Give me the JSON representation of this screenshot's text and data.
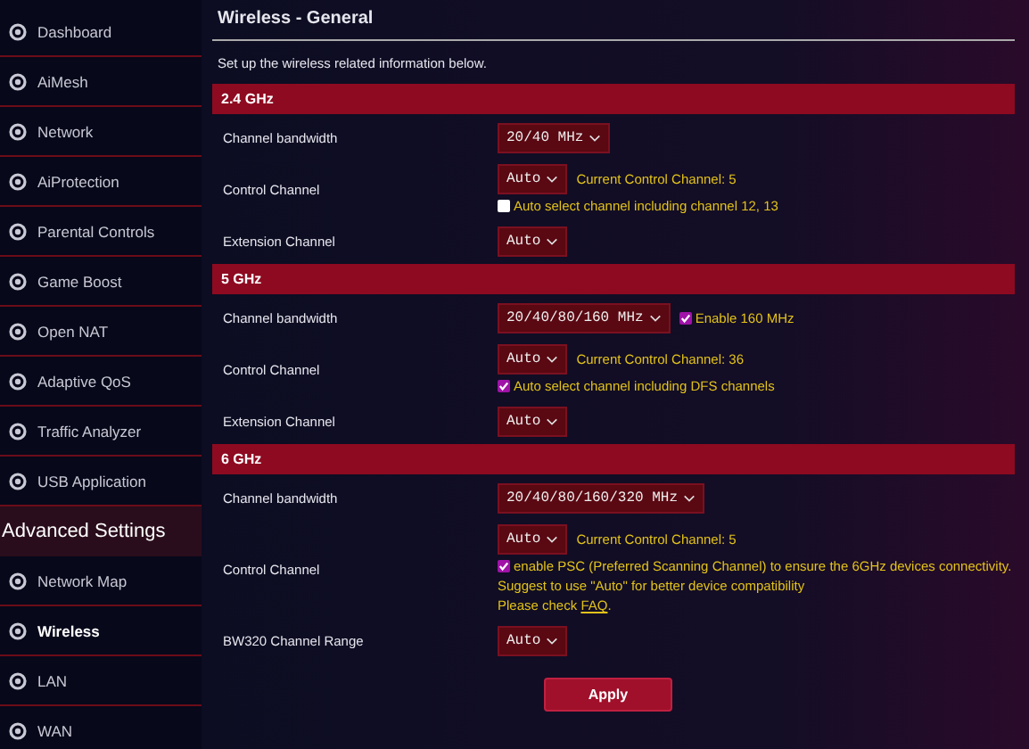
{
  "sidebar": {
    "items": [
      {
        "kind": "item",
        "label": "Dashboard",
        "selected": false
      },
      {
        "kind": "item",
        "label": "AiMesh",
        "selected": false
      },
      {
        "kind": "item",
        "label": "Network",
        "selected": false
      },
      {
        "kind": "item",
        "label": "AiProtection",
        "selected": false
      },
      {
        "kind": "item",
        "label": "Parental Controls",
        "selected": false
      },
      {
        "kind": "item",
        "label": "Game Boost",
        "selected": false
      },
      {
        "kind": "item",
        "label": "Open NAT",
        "selected": false
      },
      {
        "kind": "item",
        "label": "Adaptive QoS",
        "selected": false
      },
      {
        "kind": "item",
        "label": "Traffic Analyzer",
        "selected": false
      },
      {
        "kind": "item",
        "label": "USB Application",
        "selected": false
      },
      {
        "kind": "heading",
        "label": "Advanced Settings"
      },
      {
        "kind": "item",
        "label": "Network Map",
        "selected": false
      },
      {
        "kind": "item",
        "label": "Wireless",
        "selected": true
      },
      {
        "kind": "item",
        "label": "LAN",
        "selected": false
      },
      {
        "kind": "item",
        "label": "WAN",
        "selected": false
      }
    ]
  },
  "page": {
    "title": "Wireless - General",
    "intro": "Set up the wireless related information below."
  },
  "sections": [
    {
      "title": "2.4 GHz",
      "rows": [
        {
          "label": "Channel bandwidth",
          "lines": [
            [
              {
                "kind": "select",
                "value": "20/40 MHz"
              }
            ]
          ]
        },
        {
          "label": "Control Channel",
          "lines": [
            [
              {
                "kind": "select",
                "value": "Auto"
              },
              {
                "kind": "note",
                "text": "Current Control Channel: 5"
              }
            ],
            [
              {
                "kind": "checkbox",
                "checked": false,
                "text": "Auto select channel including channel 12, 13"
              }
            ]
          ]
        },
        {
          "label": "Extension Channel",
          "lines": [
            [
              {
                "kind": "select",
                "value": "Auto"
              }
            ]
          ]
        }
      ]
    },
    {
      "title": "5 GHz",
      "rows": [
        {
          "label": "Channel bandwidth",
          "lines": [
            [
              {
                "kind": "select",
                "value": "20/40/80/160 MHz"
              },
              {
                "kind": "checkbox",
                "checked": true,
                "text": "Enable 160 MHz"
              }
            ]
          ]
        },
        {
          "label": "Control Channel",
          "lines": [
            [
              {
                "kind": "select",
                "value": "Auto"
              },
              {
                "kind": "note",
                "text": "Current Control Channel: 36"
              }
            ],
            [
              {
                "kind": "checkbox",
                "checked": true,
                "text": "Auto select channel including DFS channels"
              }
            ]
          ]
        },
        {
          "label": "Extension Channel",
          "lines": [
            [
              {
                "kind": "select",
                "value": "Auto"
              }
            ]
          ]
        }
      ]
    },
    {
      "title": "6 GHz",
      "rows": [
        {
          "label": "Channel bandwidth",
          "lines": [
            [
              {
                "kind": "select",
                "value": "20/40/80/160/320 MHz"
              }
            ]
          ]
        },
        {
          "label": "Control Channel",
          "lines": [
            [
              {
                "kind": "select",
                "value": "Auto"
              },
              {
                "kind": "note",
                "text": "Current Control Channel: 5"
              }
            ],
            [
              {
                "kind": "checkbox",
                "checked": true,
                "text": "enable PSC (Preferred Scanning Channel) to ensure the 6GHz devices connectivity."
              }
            ],
            [
              {
                "kind": "note",
                "text": "Suggest to use \"Auto\" for better device compatibility"
              }
            ],
            [
              {
                "kind": "link_note",
                "before": "Please check ",
                "link": "FAQ",
                "after": "."
              }
            ]
          ]
        },
        {
          "label": "BW320 Channel Range",
          "lines": [
            [
              {
                "kind": "select",
                "value": "Auto"
              }
            ]
          ]
        }
      ]
    }
  ],
  "apply_button": "Apply"
}
